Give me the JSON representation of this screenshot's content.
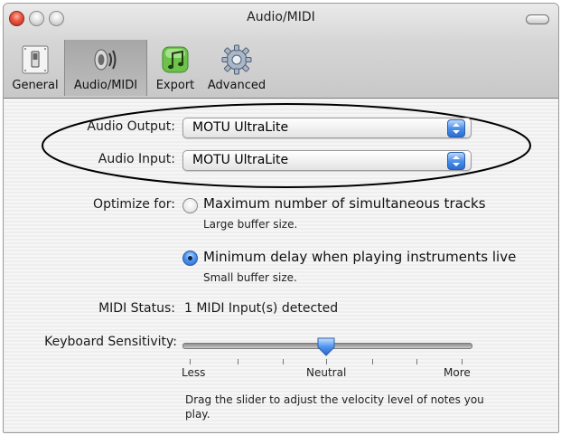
{
  "window": {
    "title": "Audio/MIDI"
  },
  "toolbar": {
    "items": [
      {
        "label": "General",
        "icon": "switch-icon"
      },
      {
        "label": "Audio/MIDI",
        "icon": "speaker-icon",
        "selected": true
      },
      {
        "label": "Export",
        "icon": "music-note-icon"
      },
      {
        "label": "Advanced",
        "icon": "gear-icon"
      }
    ]
  },
  "audio": {
    "output_label": "Audio Output:",
    "output_value": "MOTU UltraLite",
    "input_label": "Audio Input:",
    "input_value": "MOTU UltraLite"
  },
  "optimize": {
    "label": "Optimize for:",
    "options": [
      {
        "title": "Maximum number of simultaneous tracks",
        "subtitle": "Large buffer size.",
        "selected": false
      },
      {
        "title": "Minimum delay when playing instruments live",
        "subtitle": "Small buffer size.",
        "selected": true
      }
    ]
  },
  "midi": {
    "label": "MIDI Status:",
    "value": "1 MIDI Input(s) detected"
  },
  "keyboard": {
    "label": "Keyboard Sensitivity:",
    "slider_value": 0.5,
    "min_label": "Less",
    "mid_label": "Neutral",
    "max_label": "More",
    "help": "Drag the slider to adjust the velocity level of notes you play."
  },
  "colors": {
    "accent_blue": "#2a6ed6",
    "close_red": "#ec5a45"
  }
}
